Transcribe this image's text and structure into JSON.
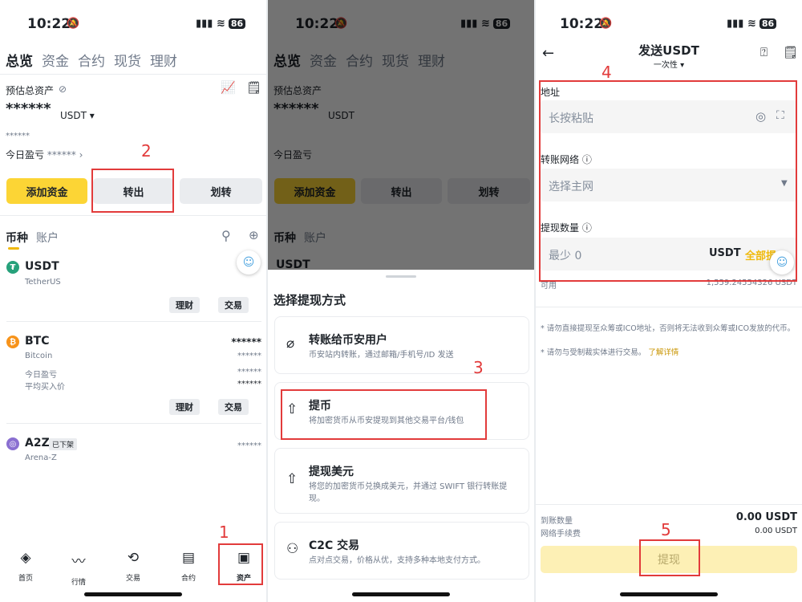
{
  "status": {
    "time": "10:22",
    "battery": "86"
  },
  "annotations": {
    "n1": "1",
    "n2": "2",
    "n3": "3",
    "n4": "4",
    "n5": "5"
  },
  "assets": {
    "tabs": [
      "总览",
      "资金",
      "合约",
      "现货",
      "理财"
    ],
    "est_label": "预估总资产",
    "masked_balance": "******",
    "currency": "USDT",
    "masked_small": "******",
    "today_pnl": "今日盈亏",
    "today_pnl_value": "******",
    "buttons": {
      "add_funds": "添加资金",
      "transfer_out": "转出",
      "transfer": "划转"
    },
    "list_tabs": [
      "币种",
      "账户"
    ],
    "coins": [
      {
        "symbol": "USDT",
        "name": "TetherUS",
        "actions": [
          "理财",
          "交易"
        ]
      },
      {
        "symbol": "BTC",
        "name": "Bitcoin",
        "amount": "******",
        "sub_amount": "******",
        "today_label": "今日盈亏",
        "today_value": "******",
        "avg_label": "平均买入价",
        "avg_value": "******",
        "actions": [
          "理财",
          "交易"
        ]
      },
      {
        "symbol": "A2Z",
        "badge": "已下架",
        "name": "Arena-Z",
        "amount": "******"
      }
    ],
    "bottom_nav": [
      "首页",
      "行情",
      "交易",
      "合约",
      "资产"
    ]
  },
  "sheet": {
    "title": "选择提现方式",
    "options": [
      {
        "title": "转账给币安用户",
        "desc": "币安站内转账，通过邮箱/手机号/ID 发送"
      },
      {
        "title": "提币",
        "desc": "将加密货币从币安提现到其他交易平台/钱包"
      },
      {
        "title": "提现美元",
        "desc": "将您的加密货币兑换成美元，并通过 SWIFT 银行转账提现。"
      },
      {
        "title": "C2C 交易",
        "desc": "点对点交易，价格从优，支持多种本地支付方式。"
      }
    ]
  },
  "send": {
    "title": "发送USDT",
    "subtitle": "一次性 ▾",
    "address_label": "地址",
    "address_placeholder": "长按粘贴",
    "network_label": "转账网络 ⓘ",
    "network_placeholder": "选择主网",
    "amount_label": "提现数量 ⓘ",
    "amount_placeholder": "最少 0",
    "amount_unit": "USDT",
    "all_label": "全部提",
    "available_label": "可用",
    "available_value": "1,559.24554326 USDT",
    "note1": "* 请勿直接提现至众筹或ICO地址，否则将无法收到众筹或ICO发放的代币。",
    "note2": "* 请勿与受制裁实体进行交易。",
    "learn_more": "了解详情",
    "receive_label": "到账数量",
    "receive_value": "0.00 USDT",
    "fee_label": "网络手续费",
    "fee_value": "0.00 USDT",
    "submit": "提现"
  }
}
